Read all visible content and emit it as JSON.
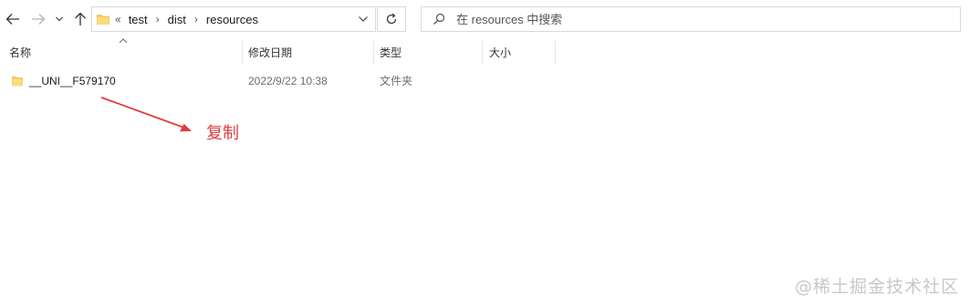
{
  "toolbar": {
    "back_icon": "arrow-left-icon",
    "forward_icon": "arrow-right-icon",
    "recent_icon": "chevron-down-icon",
    "up_icon": "arrow-up-icon"
  },
  "address": {
    "lead": "«",
    "crumbs": [
      "test",
      "dist",
      "resources"
    ]
  },
  "search": {
    "placeholder": "在 resources 中搜索"
  },
  "columns": {
    "name": "名称",
    "modified": "修改日期",
    "type": "类型",
    "size": "大小"
  },
  "files": [
    {
      "name": "__UNI__F579170",
      "modified": "2022/9/22 10:38",
      "type": "文件夹",
      "size": ""
    }
  ],
  "annotation": {
    "text": "复制",
    "color": "#e03b3b"
  },
  "watermark": "@稀土掘金技术社区"
}
